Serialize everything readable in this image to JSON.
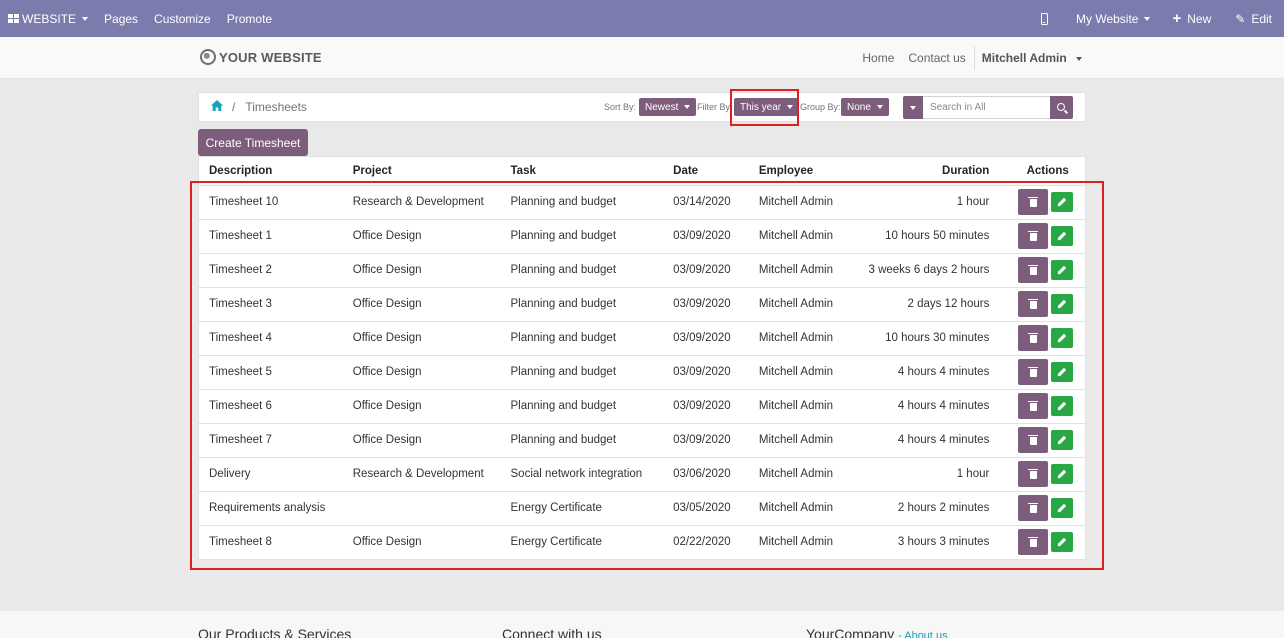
{
  "topbar": {
    "website_label": "WEBSITE",
    "pages_label": "Pages",
    "customize_label": "Customize",
    "promote_label": "Promote",
    "my_website_label": "My Website",
    "new_label": "New",
    "edit_label": "Edit",
    "color": "#7c7bad"
  },
  "site": {
    "logo_text": "YOUR WEBSITE",
    "nav": {
      "home": "Home",
      "contact": "Contact us",
      "user": "Mitchell Admin"
    }
  },
  "breadcrumb": {
    "current": "Timesheets"
  },
  "controls": {
    "sort_label": "Sort By:",
    "sort_value": "Newest",
    "filter_label": "Filter By",
    "filter_value": "This year",
    "group_label": "Group By:",
    "group_value": "None",
    "search_placeholder": "Search in All",
    "accent_color": "#7d5d7c"
  },
  "create_button": "Create Timesheet",
  "table": {
    "columns": {
      "description": "Description",
      "project": "Project",
      "task": "Task",
      "date": "Date",
      "employee": "Employee",
      "duration": "Duration",
      "actions": "Actions"
    },
    "rows": [
      {
        "description": "Timesheet 10",
        "project": "Research & Development",
        "task": "Planning and budget",
        "date": "03/14/2020",
        "employee": "Mitchell Admin",
        "duration": "1 hour"
      },
      {
        "description": "Timesheet 1",
        "project": "Office Design",
        "task": "Planning and budget",
        "date": "03/09/2020",
        "employee": "Mitchell Admin",
        "duration": "10 hours 50 minutes"
      },
      {
        "description": "Timesheet 2",
        "project": "Office Design",
        "task": "Planning and budget",
        "date": "03/09/2020",
        "employee": "Mitchell Admin",
        "duration": "3 weeks 6 days 2 hours"
      },
      {
        "description": "Timesheet 3",
        "project": "Office Design",
        "task": "Planning and budget",
        "date": "03/09/2020",
        "employee": "Mitchell Admin",
        "duration": "2 days 12 hours"
      },
      {
        "description": "Timesheet 4",
        "project": "Office Design",
        "task": "Planning and budget",
        "date": "03/09/2020",
        "employee": "Mitchell Admin",
        "duration": "10 hours 30 minutes"
      },
      {
        "description": "Timesheet 5",
        "project": "Office Design",
        "task": "Planning and budget",
        "date": "03/09/2020",
        "employee": "Mitchell Admin",
        "duration": "4 hours 4 minutes"
      },
      {
        "description": "Timesheet 6",
        "project": "Office Design",
        "task": "Planning and budget",
        "date": "03/09/2020",
        "employee": "Mitchell Admin",
        "duration": "4 hours 4 minutes"
      },
      {
        "description": "Timesheet 7",
        "project": "Office Design",
        "task": "Planning and budget",
        "date": "03/09/2020",
        "employee": "Mitchell Admin",
        "duration": "4 hours 4 minutes"
      },
      {
        "description": "Delivery",
        "project": "Research & Development",
        "task": "Social network integration",
        "date": "03/06/2020",
        "employee": "Mitchell Admin",
        "duration": "1 hour"
      },
      {
        "description": "Requirements analysis",
        "project": "",
        "task": "Energy Certificate",
        "date": "03/05/2020",
        "employee": "Mitchell Admin",
        "duration": "2 hours 2 minutes"
      },
      {
        "description": "Timesheet 8",
        "project": "Office Design",
        "task": "Energy Certificate",
        "date": "02/22/2020",
        "employee": "Mitchell Admin",
        "duration": "3 hours 3 minutes"
      }
    ],
    "delete_color": "#7d5d7c",
    "edit_color": "#28a745"
  },
  "footer": {
    "products_heading": "Our Products & Services",
    "connect_heading": "Connect with us",
    "company_heading": "YourCompany",
    "about_link": "About us"
  },
  "icons": {
    "apps": "grid-icon",
    "device": "mobile-icon",
    "new": "plus-icon",
    "edit": "pencil-icon",
    "logo": "globe-icon",
    "home": "home-icon",
    "search": "search-icon",
    "delete": "trash-icon",
    "row_edit": "pencil-icon"
  }
}
